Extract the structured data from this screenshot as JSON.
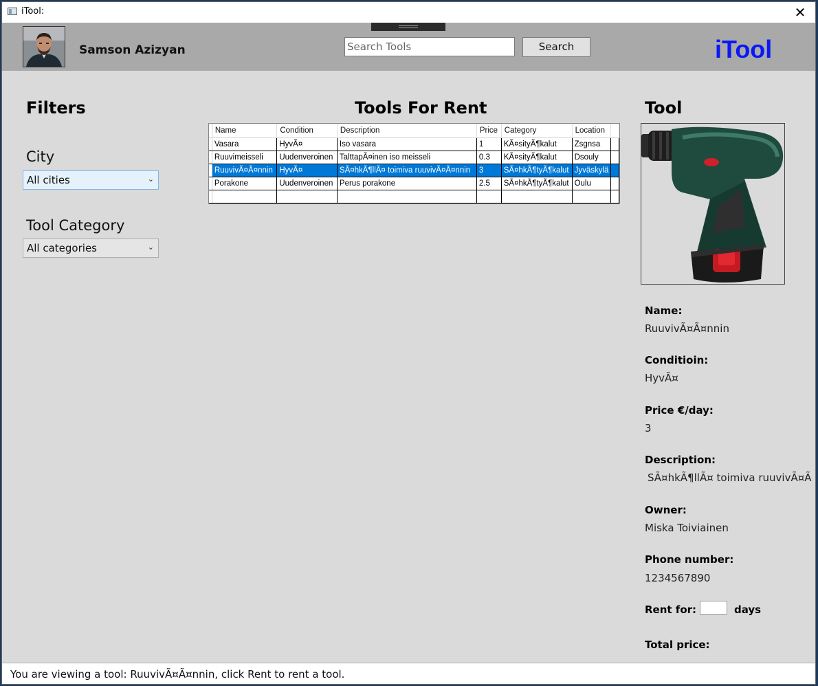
{
  "window": {
    "title": "iTool:",
    "close_glyph": "✕"
  },
  "header": {
    "user_name": "Samson Azizyan",
    "search_placeholder": "Search Tools",
    "search_button": "Search",
    "brand": "iTool"
  },
  "filters": {
    "title": "Filters",
    "city_label": "City",
    "city_value": "All cities",
    "category_label": "Tool Category",
    "category_value": "All categories"
  },
  "tools": {
    "title": "Tools For Rent",
    "columns": [
      "Name",
      "Condition",
      "Description",
      "Price",
      "Category",
      "Location"
    ],
    "rows": [
      [
        "Vasara",
        "HyvÃ¤",
        "Iso vasara",
        "1",
        "KÃ¤sityÃ¶kalut",
        "Zsgnsa"
      ],
      [
        "Ruuvimeisseli",
        "Uudenveroinen",
        "TalttapÃ¤inen iso meisseli",
        "0.3",
        "KÃ¤sityÃ¶kalut",
        "Dsouly"
      ],
      [
        "RuuvivÃ¤Ã¤nnin",
        "HyvÃ¤",
        "SÃ¤hkÃ¶llÃ¤ toimiva ruuvivÃ¤Ã¤nnin",
        "3",
        "SÃ¤hkÃ¶tyÃ¶kalut",
        "Jyväskylä"
      ],
      [
        "Porakone",
        "Uudenveroinen",
        "Perus porakone",
        "2.5",
        "SÃ¤hkÃ¶tyÃ¶kalut",
        "Oulu"
      ],
      [
        "",
        "",
        "",
        "",
        "",
        ""
      ]
    ],
    "selected_row": 2
  },
  "tool": {
    "title": "Tool",
    "image_icon": "cordless-drill",
    "name_label": "Name:",
    "name_value": "RuuvivÃ¤Ã¤nnin",
    "condition_label": "Conditioin:",
    "condition_value": "HyvÃ¤",
    "price_label": "Price €/day:",
    "price_value": "3",
    "description_label": "Description:",
    "description_value": "SÃ¤hkÃ¶llÃ¤ toimiva ruuvivÃ¤Ã",
    "owner_label": "Owner:",
    "owner_value": "Miska Toiviainen",
    "phone_label": "Phone number:",
    "phone_value": "1234567890",
    "rent_for_label": "Rent for:",
    "days_value": "",
    "days_label": "days",
    "total_label": "Total price:"
  },
  "status": {
    "text": "You are viewing a tool: RuuvivÃ¤Ã¤nnin, click Rent to rent a tool."
  },
  "colors": {
    "brand": "#0a18f5",
    "selection": "#0078d7",
    "header_bg": "#a9a9a9",
    "window_bg": "#dadada"
  }
}
